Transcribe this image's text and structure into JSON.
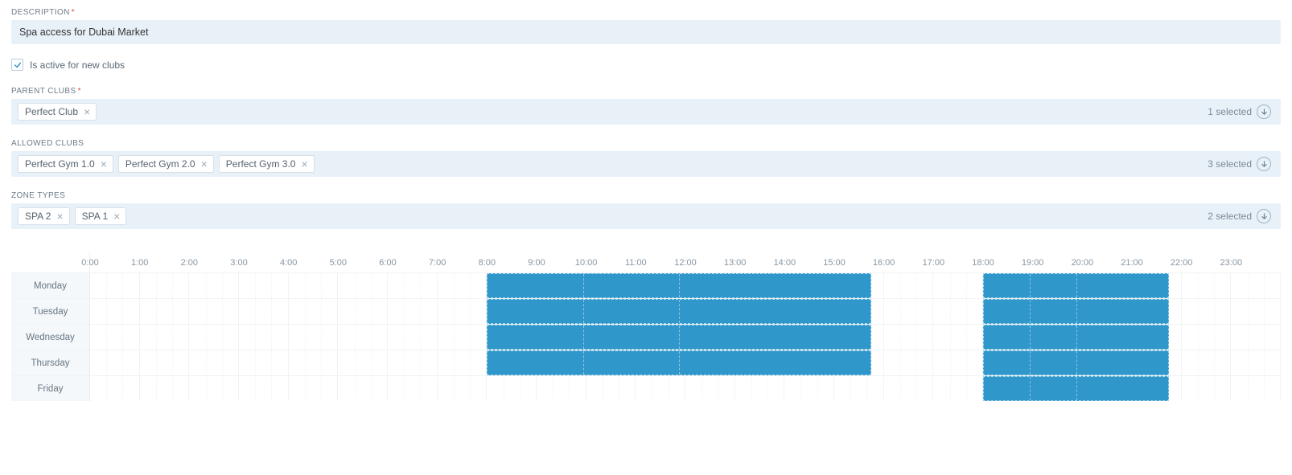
{
  "description": {
    "label": "DESCRIPTION",
    "required": true,
    "value": "Spa access for Dubai Market"
  },
  "active_checkbox": {
    "checked": true,
    "label": "Is active for new clubs"
  },
  "parent_clubs": {
    "label": "PARENT CLUBS",
    "required": true,
    "chips": [
      "Perfect Club"
    ],
    "count_text": "1 selected"
  },
  "allowed_clubs": {
    "label": "ALLOWED CLUBS",
    "required": false,
    "chips": [
      "Perfect Gym 1.0",
      "Perfect Gym 2.0",
      "Perfect Gym 3.0"
    ],
    "count_text": "3 selected"
  },
  "zone_types": {
    "label": "ZONE TYPES",
    "required": false,
    "chips": [
      "SPA 2",
      "SPA 1"
    ],
    "count_text": "2 selected"
  },
  "schedule": {
    "hours": [
      "0:00",
      "1:00",
      "2:00",
      "3:00",
      "4:00",
      "5:00",
      "6:00",
      "7:00",
      "8:00",
      "9:00",
      "10:00",
      "11:00",
      "12:00",
      "13:00",
      "14:00",
      "15:00",
      "16:00",
      "17:00",
      "18:00",
      "19:00",
      "20:00",
      "21:00",
      "22:00",
      "23:00"
    ],
    "days": [
      "Monday",
      "Tuesday",
      "Wednesday",
      "Thursday",
      "Friday"
    ],
    "blocks": [
      {
        "day": "Monday",
        "start": 8.0,
        "end": 15.75
      },
      {
        "day": "Monday",
        "start": 18.0,
        "end": 21.75
      },
      {
        "day": "Tuesday",
        "start": 8.0,
        "end": 15.75
      },
      {
        "day": "Tuesday",
        "start": 18.0,
        "end": 21.75
      },
      {
        "day": "Wednesday",
        "start": 8.0,
        "end": 15.75
      },
      {
        "day": "Wednesday",
        "start": 18.0,
        "end": 21.75
      },
      {
        "day": "Thursday",
        "start": 8.0,
        "end": 15.75
      },
      {
        "day": "Thursday",
        "start": 18.0,
        "end": 21.75
      },
      {
        "day": "Friday",
        "start": 18.0,
        "end": 21.75
      }
    ]
  }
}
